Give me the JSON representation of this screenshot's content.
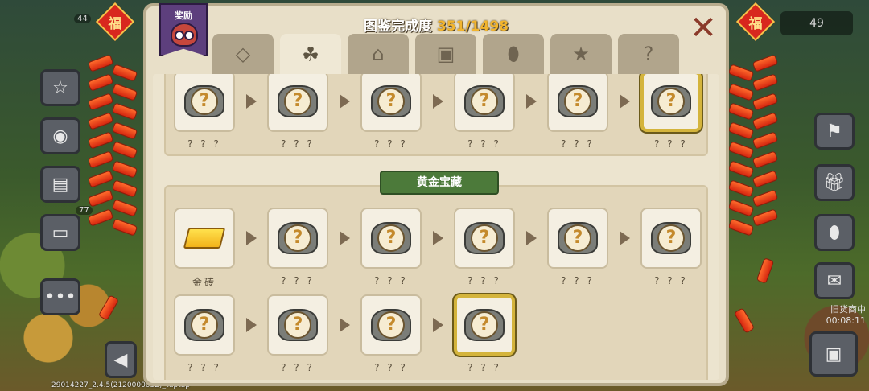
{
  "panel": {
    "title": "图鉴完成度",
    "progress": "351/1498",
    "reward_label": "奖励",
    "close_label": "✕"
  },
  "tabs": [
    {
      "icon": "gem-icon",
      "glyph": "◇"
    },
    {
      "icon": "clover-icon",
      "glyph": "☘"
    },
    {
      "icon": "house-icon",
      "glyph": "⌂"
    },
    {
      "icon": "chest-icon",
      "glyph": "▣"
    },
    {
      "icon": "egg-icon",
      "glyph": "⬮"
    },
    {
      "icon": "star-icon",
      "glyph": "★"
    },
    {
      "icon": "question-icon",
      "glyph": "?"
    }
  ],
  "active_tab_index": 1,
  "upper_row": {
    "labels": [
      "? ? ?",
      "? ? ?",
      "? ? ?",
      "? ? ?",
      "? ? ?",
      "? ? ?"
    ]
  },
  "gold_section": {
    "title": "黄金宝藏",
    "row1": [
      "金砖",
      "? ? ?",
      "? ? ?",
      "? ? ?",
      "? ? ?",
      "? ? ?"
    ],
    "row2": [
      "? ? ?",
      "? ? ?",
      "? ? ?",
      "? ? ?"
    ]
  },
  "hud": {
    "top_right_count": "49",
    "left_badge_1": "44",
    "left_badge_2": "77",
    "timer_label": "旧货商中",
    "timer_value": "00:08:11",
    "version": "29014227_2.4.5(2120000032)_Taptap"
  },
  "decor": {
    "fu_char": "福"
  },
  "colors": {
    "accent_gold": "#f2b52e",
    "header_green": "#4c7a3a",
    "panel_bg": "#e8dfc8"
  }
}
